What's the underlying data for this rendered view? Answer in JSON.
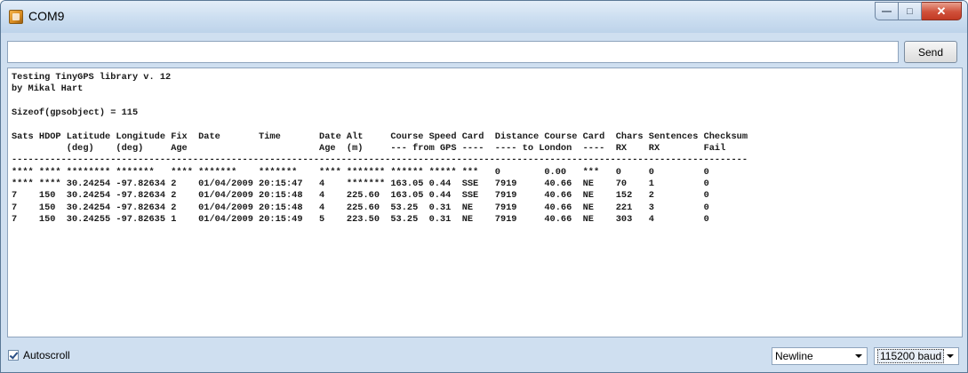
{
  "window": {
    "title": "COM9"
  },
  "input": {
    "value": "",
    "placeholder": ""
  },
  "send_label": "Send",
  "console_lines": [
    "Testing TinyGPS library v. 12",
    "by Mikal Hart",
    "",
    "Sizeof(gpsobject) = 115",
    "",
    "Sats HDOP Latitude Longitude Fix  Date       Time       Date Alt     Course Speed Card  Distance Course Card  Chars Sentences Checksum",
    "          (deg)    (deg)     Age                        Age  (m)     --- from GPS ----  ---- to London  ----  RX    RX        Fail",
    "--------------------------------------------------------------------------------------------------------------------------------------",
    "**** **** ******** *******   **** *******    *******    **** ******* ****** ***** ***   0        0.00   ***   0     0         0",
    "**** **** 30.24254 -97.82634 2    01/04/2009 20:15:47   4    ******* 163.05 0.44  SSE   7919     40.66  NE    70    1         0",
    "7    150  30.24254 -97.82634 2    01/04/2009 20:15:48   4    225.60  163.05 0.44  SSE   7919     40.66  NE    152   2         0",
    "7    150  30.24254 -97.82634 2    01/04/2009 20:15:48   4    225.60  53.25  0.31  NE    7919     40.66  NE    221   3         0",
    "7    150  30.24255 -97.82635 1    01/04/2009 20:15:49   5    223.50  53.25  0.31  NE    7919     40.66  NE    303   4         0"
  ],
  "autoscroll": {
    "label": "Autoscroll",
    "checked": true
  },
  "line_ending": {
    "selected": "Newline"
  },
  "baud_rate": {
    "selected": "115200 baud"
  }
}
